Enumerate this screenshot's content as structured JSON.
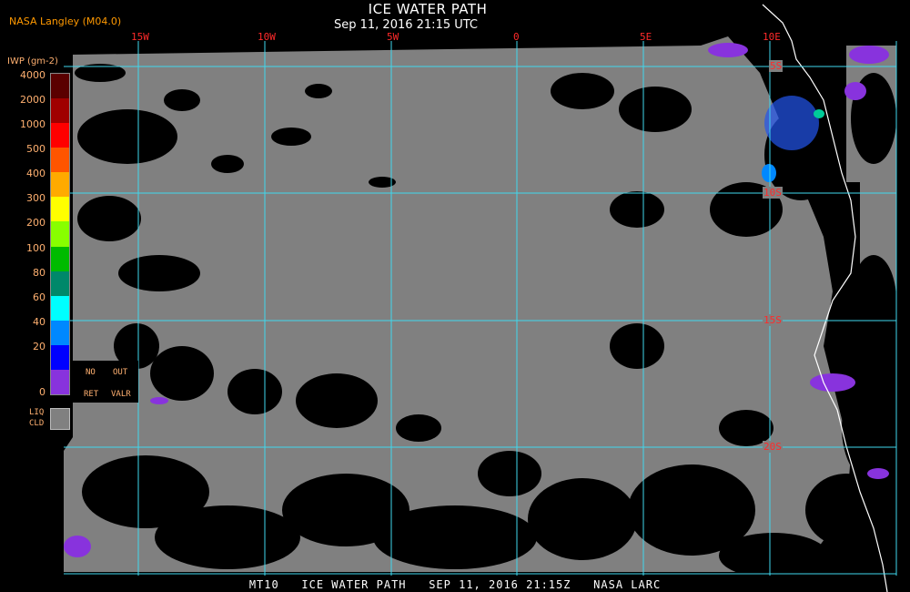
{
  "header": {
    "title": "ICE WATER PATH",
    "datetime": "Sep 11, 2016 21:15 UTC",
    "credit": "NASA Langley (M04.0)"
  },
  "legend": {
    "units": "IWP (gm-2)",
    "levels": [
      {
        "label": "4000",
        "color": "#5a0000"
      },
      {
        "label": "2000",
        "color": "#a00000"
      },
      {
        "label": "1000",
        "color": "#ff0000"
      },
      {
        "label": "500",
        "color": "#ff5500"
      },
      {
        "label": "400",
        "color": "#ffaa00"
      },
      {
        "label": "300",
        "color": "#ffff00"
      },
      {
        "label": "200",
        "color": "#88ff00"
      },
      {
        "label": "100",
        "color": "#00bb00"
      },
      {
        "label": "80",
        "color": "#00886a"
      },
      {
        "label": "60",
        "color": "#00ffff"
      },
      {
        "label": "40",
        "color": "#0088ff"
      },
      {
        "label": "20",
        "color": "#0000ff"
      },
      {
        "label": "0",
        "color": "#8833dd"
      }
    ],
    "no_ret_label_1": "NO",
    "no_ret_label_2": "RET",
    "out_valr_label_1": "OUT",
    "out_valr_label_2": "VALR",
    "liq_cld_label_1": "LIQ",
    "liq_cld_label_2": "CLD",
    "liq_cld_color": "#808080"
  },
  "grid": {
    "longitudes": [
      "15W",
      "10W",
      "5W",
      "0",
      "5E",
      "10E"
    ],
    "latitudes": [
      "5S",
      "10S",
      "15S",
      "20S"
    ],
    "line_color": "#3fd8ee"
  },
  "footer": {
    "text": "MT10   ICE WATER PATH   SEP 11, 2016 21:15Z   NASA LARC"
  }
}
